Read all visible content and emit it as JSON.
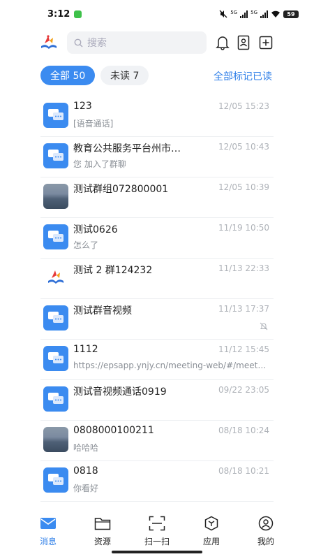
{
  "status": {
    "time": "3:12",
    "battery": "59",
    "net1": "5G",
    "net2": "5G"
  },
  "search": {
    "placeholder": "搜索"
  },
  "filters": {
    "all": "全部 50",
    "unread": "未读 7",
    "mark_all_read": "全部标记已读"
  },
  "conversations": [
    {
      "title": "123",
      "time": "12/05 15:23",
      "preview": "[语音通话]",
      "avatar": "chat"
    },
    {
      "title": "教育公共服务平台州市…",
      "time": "12/05 10:43",
      "preview": "您 加入了群聊",
      "avatar": "chat"
    },
    {
      "title": "测试群组072800001",
      "time": "12/05 10:39",
      "preview": "",
      "avatar": "photo"
    },
    {
      "title": "测试0626",
      "time": "11/19 10:50",
      "preview": "怎么了",
      "avatar": "chat"
    },
    {
      "title": "测试 2 群124232",
      "time": "11/13 22:33",
      "preview": "",
      "avatar": "logo"
    },
    {
      "title": "测试群音视频",
      "time": "11/13 17:37",
      "preview": "",
      "avatar": "chat",
      "muted": true
    },
    {
      "title": "1112",
      "time": "11/12 15:45",
      "preview": "https://epsapp.ynjy.cn/meeting-web/#/meet…",
      "avatar": "chat"
    },
    {
      "title": "测试音视频通话0919",
      "time": "09/22 23:05",
      "preview": "",
      "avatar": "chat"
    },
    {
      "title": "0808000100211",
      "time": "08/18 10:24",
      "preview": "哈哈哈",
      "avatar": "photo"
    },
    {
      "title": "0818",
      "time": "08/18 10:21",
      "preview": "你看好",
      "avatar": "chat"
    }
  ],
  "tabbar": {
    "messages": "消息",
    "resources": "资源",
    "scan": "扫一扫",
    "apps": "应用",
    "mine": "我的"
  },
  "colors": {
    "accent": "#3b8bf0",
    "link": "#2f7fe8"
  }
}
